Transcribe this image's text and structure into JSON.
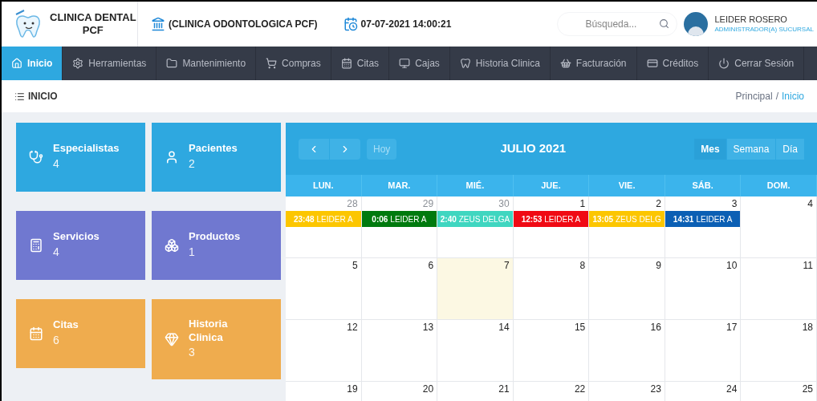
{
  "brand": {
    "name": "CLINICA DENTAL",
    "sub": "PCF"
  },
  "clinic": "(CLINICA ODONTOLOGICA PCF)",
  "datetime": "07-07-2021 14:00:21",
  "search": {
    "placeholder": "Búsqueda..."
  },
  "user": {
    "name": "LEIDER ROSERO",
    "role": "ADMINISTRADOR(A) SUCURSAL"
  },
  "nav": [
    {
      "label": "Inicio",
      "selected": true
    },
    {
      "label": "Herramientas",
      "selected": false
    },
    {
      "label": "Mantenimiento",
      "selected": false
    },
    {
      "label": "Compras",
      "selected": false
    },
    {
      "label": "Citas",
      "selected": false
    },
    {
      "label": "Cajas",
      "selected": false
    },
    {
      "label": "Historia Clinica",
      "selected": false
    },
    {
      "label": "Facturación",
      "selected": false
    },
    {
      "label": "Créditos",
      "selected": false
    },
    {
      "label": "Cerrar Sesión",
      "selected": false
    }
  ],
  "page_title": "INICIO",
  "breadcrumb": {
    "items": [
      "Principal",
      "Inicio"
    ],
    "separator": "/"
  },
  "tiles": [
    {
      "label": "Especialistas",
      "count": "4",
      "color": "#2ea8e0"
    },
    {
      "label": "Pacientes",
      "count": "2",
      "color": "#2ea8e0"
    },
    {
      "label": "Servicios",
      "count": "4",
      "color": "#7078d0"
    },
    {
      "label": "Productos",
      "count": "1",
      "color": "#7078d0"
    },
    {
      "label": "Citas",
      "count": "6",
      "color": "#efac4e"
    },
    {
      "label": "Historia Clinica",
      "count": "3",
      "color": "#efac4e"
    }
  ],
  "calendar": {
    "title": "JULIO 2021",
    "today_button": "Hoy",
    "views": [
      {
        "label": "Mes",
        "selected": true
      },
      {
        "label": "Semana",
        "selected": false
      },
      {
        "label": "Día",
        "selected": false
      }
    ],
    "weekdays": [
      "LUN.",
      "MAR.",
      "MIÉ.",
      "JUE.",
      "VIE.",
      "SÁB.",
      "DOM."
    ],
    "weeks": [
      [
        {
          "day": "28",
          "other_month": true,
          "today": false,
          "events": [
            {
              "time": "23:48",
              "title": "LEIDER A",
              "color": "#fcc600"
            }
          ]
        },
        {
          "day": "29",
          "other_month": true,
          "today": false,
          "events": [
            {
              "time": "0:06",
              "title": "LEIDER A",
              "color": "#007a0e"
            }
          ]
        },
        {
          "day": "30",
          "other_month": true,
          "today": false,
          "events": [
            {
              "time": "2:40",
              "title": "ZEUS DELGA",
              "color": "#3fd6c0"
            }
          ]
        },
        {
          "day": "1",
          "other_month": false,
          "today": false,
          "events": [
            {
              "time": "12:53",
              "title": "LEIDER A",
              "color": "#f00a14"
            }
          ]
        },
        {
          "day": "2",
          "other_month": false,
          "today": false,
          "events": [
            {
              "time": "13:05",
              "title": "ZEUS DELG",
              "color": "#fcc600"
            }
          ]
        },
        {
          "day": "3",
          "other_month": false,
          "today": false,
          "events": [
            {
              "time": "14:31",
              "title": "LEIDER A",
              "color": "#0b5fb4"
            }
          ]
        },
        {
          "day": "4",
          "other_month": false,
          "today": false
        }
      ],
      [
        {
          "day": "5",
          "other_month": false,
          "today": false
        },
        {
          "day": "6",
          "other_month": false,
          "today": false
        },
        {
          "day": "7",
          "other_month": false,
          "today": true
        },
        {
          "day": "8",
          "other_month": false,
          "today": false
        },
        {
          "day": "9",
          "other_month": false,
          "today": false
        },
        {
          "day": "10",
          "other_month": false,
          "today": false
        },
        {
          "day": "11",
          "other_month": false,
          "today": false
        }
      ],
      [
        {
          "day": "12",
          "other_month": false,
          "today": false
        },
        {
          "day": "13",
          "other_month": false,
          "today": false
        },
        {
          "day": "14",
          "other_month": false,
          "today": false
        },
        {
          "day": "15",
          "other_month": false,
          "today": false
        },
        {
          "day": "16",
          "other_month": false,
          "today": false
        },
        {
          "day": "17",
          "other_month": false,
          "today": false
        },
        {
          "day": "18",
          "other_month": false,
          "today": false
        }
      ],
      [
        {
          "day": "19",
          "other_month": false,
          "today": false
        },
        {
          "day": "20",
          "other_month": false,
          "today": false
        },
        {
          "day": "21",
          "other_month": false,
          "today": false
        },
        {
          "day": "22",
          "other_month": false,
          "today": false
        },
        {
          "day": "23",
          "other_month": false,
          "today": false
        },
        {
          "day": "24",
          "other_month": false,
          "today": false
        },
        {
          "day": "25",
          "other_month": false,
          "today": false
        }
      ]
    ]
  }
}
